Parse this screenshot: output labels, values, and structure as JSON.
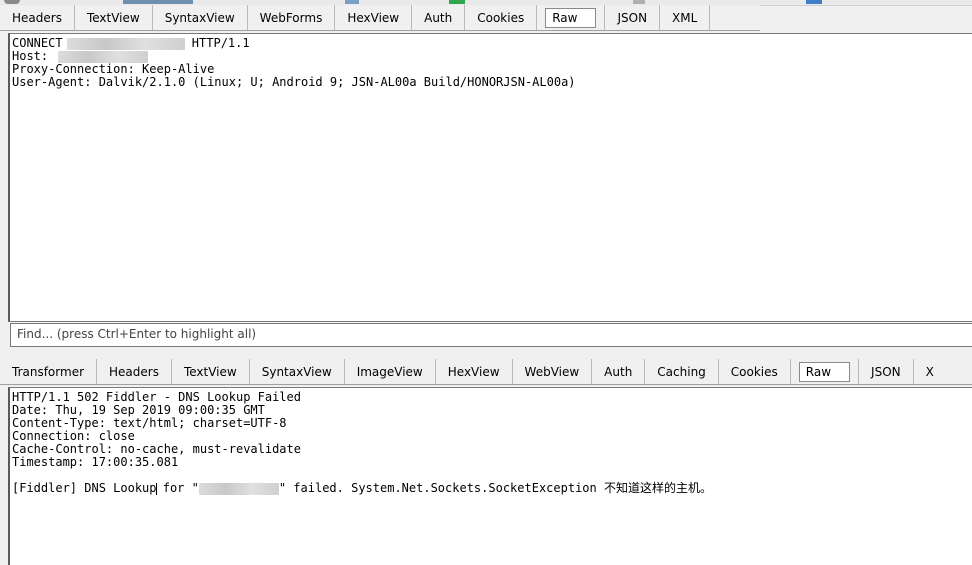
{
  "request": {
    "tabs": [
      {
        "label": "Headers"
      },
      {
        "label": "TextView"
      },
      {
        "label": "SyntaxView"
      },
      {
        "label": "WebForms"
      },
      {
        "label": "HexView"
      },
      {
        "label": "Auth"
      },
      {
        "label": "Cookies"
      },
      {
        "label": "Raw",
        "active": true
      },
      {
        "label": "JSON"
      },
      {
        "label": "XML"
      }
    ],
    "lines": {
      "l1_method": "CONNECT",
      "l1_proto": " HTTP/1.1",
      "l2": "Host:",
      "l3": "Proxy-Connection: Keep-Alive",
      "l4": "User-Agent: Dalvik/2.1.0 (Linux; U; Android 9; JSN-AL00a Build/HONORJSN-AL00a)"
    },
    "find_placeholder": "Find... (press Ctrl+Enter to highlight all)"
  },
  "response": {
    "tabs": [
      {
        "label": "Transformer"
      },
      {
        "label": "Headers"
      },
      {
        "label": "TextView"
      },
      {
        "label": "SyntaxView"
      },
      {
        "label": "ImageView"
      },
      {
        "label": "HexView"
      },
      {
        "label": "WebView"
      },
      {
        "label": "Auth"
      },
      {
        "label": "Caching"
      },
      {
        "label": "Cookies"
      },
      {
        "label": "Raw",
        "active": true
      },
      {
        "label": "JSON"
      },
      {
        "label": "X"
      }
    ],
    "lines": {
      "l1": "HTTP/1.1 502 Fiddler - DNS Lookup Failed",
      "l2": "Date: Thu, 19 Sep 2019 09:00:35 GMT",
      "l3": "Content-Type: text/html; charset=UTF-8",
      "l4": "Connection: close",
      "l5": "Cache-Control: no-cache, must-revalidate",
      "l6": "Timestamp: 17:00:35.081",
      "l8_a": "[Fiddler] DNS Lookup",
      "l8_b": " for \"",
      "l8_c": "\" failed. System.Net.Sockets.SocketException 不知道这样的主机。"
    }
  }
}
